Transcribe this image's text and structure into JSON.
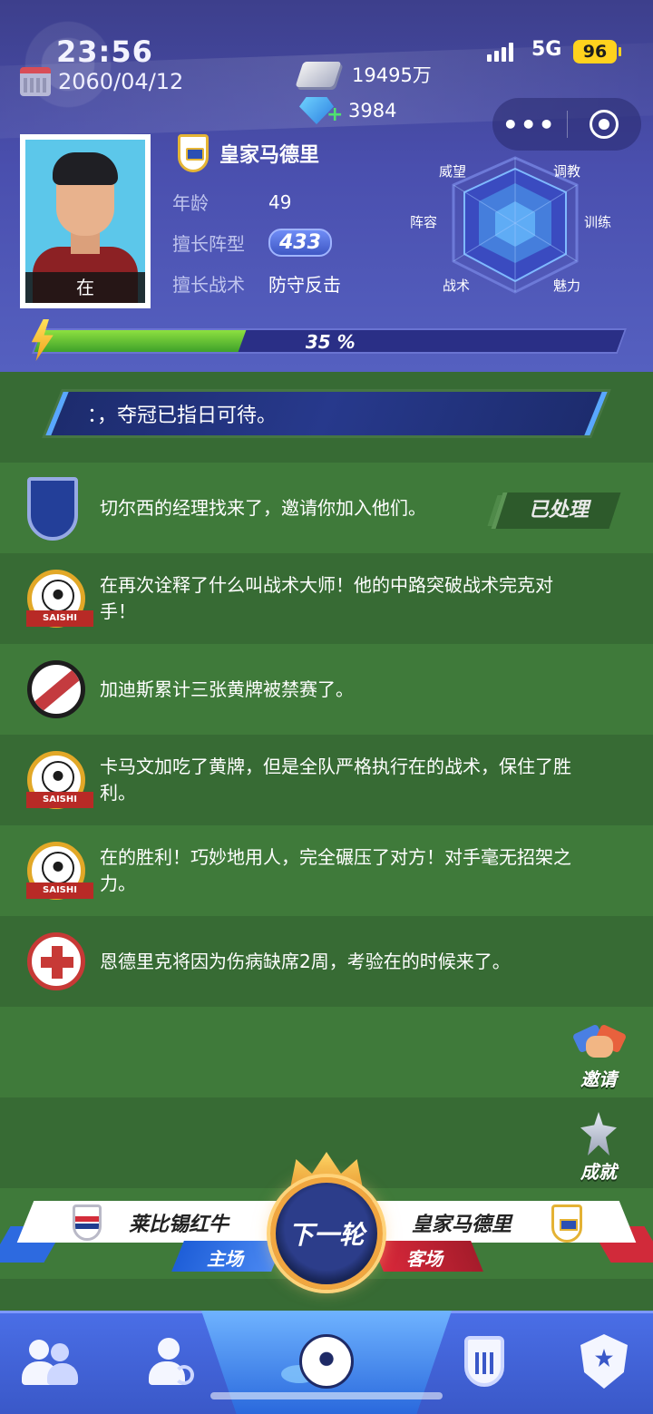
{
  "status_bar": {
    "time": "23:56",
    "network": "5G",
    "battery": "96"
  },
  "header": {
    "date": "2060/04/12",
    "money": "19495万",
    "gems": "3984",
    "capsule_more": "•••",
    "team_name": "皇家马德里",
    "avatar_label": "在",
    "age_label": "年龄",
    "age_value": "49",
    "formation_label": "擅长阵型",
    "formation_value": "433",
    "tactic_label": "擅长战术",
    "tactic_value": "防守反击",
    "progress_percent": 35,
    "progress_text": "35 %",
    "radar_labels": {
      "prestige": "威望",
      "coaching": "调教",
      "lineup": "阵容",
      "training": "训练",
      "tactics": "战术",
      "charm": "魅力"
    }
  },
  "banner": {
    "text": "：，夺冠已指日可待。"
  },
  "news": [
    {
      "icon": "shield-icon",
      "text": "切尔西的经理找来了，邀请你加入他们。",
      "action": "已处理"
    },
    {
      "icon": "soccer-badge-icon",
      "badge": "SAISHI",
      "text": "在再次诠释了什么叫战术大师！他的中路突破战术完克对手！"
    },
    {
      "icon": "ban-icon",
      "text": "加迪斯累计三张黄牌被禁赛了。"
    },
    {
      "icon": "soccer-badge-icon",
      "badge": "SAISHI",
      "text": "卡马文加吃了黄牌，但是全队严格执行在的战术，保住了胜利。"
    },
    {
      "icon": "soccer-badge-icon",
      "badge": "SAISHI",
      "text": "在的胜利！巧妙地用人，完全碾压了对方！对手毫无招架之力。"
    },
    {
      "icon": "medical-cross-icon",
      "text": "恩德里克将因为伤病缺席2周，考验在的时候来了。"
    }
  ],
  "side_buttons": {
    "invite": "邀请",
    "achievement": "成就"
  },
  "match": {
    "home_team": "莱比锡红牛",
    "home_tag": "主场",
    "away_team": "皇家马德里",
    "away_tag": "客场",
    "next_round": "下一轮"
  },
  "colors": {
    "header_bg": "#4a4fae",
    "field_green": "#3f7a3a",
    "accent_blue": "#2d6ae0",
    "accent_red": "#d12a3a",
    "gold": "#e4b234"
  }
}
